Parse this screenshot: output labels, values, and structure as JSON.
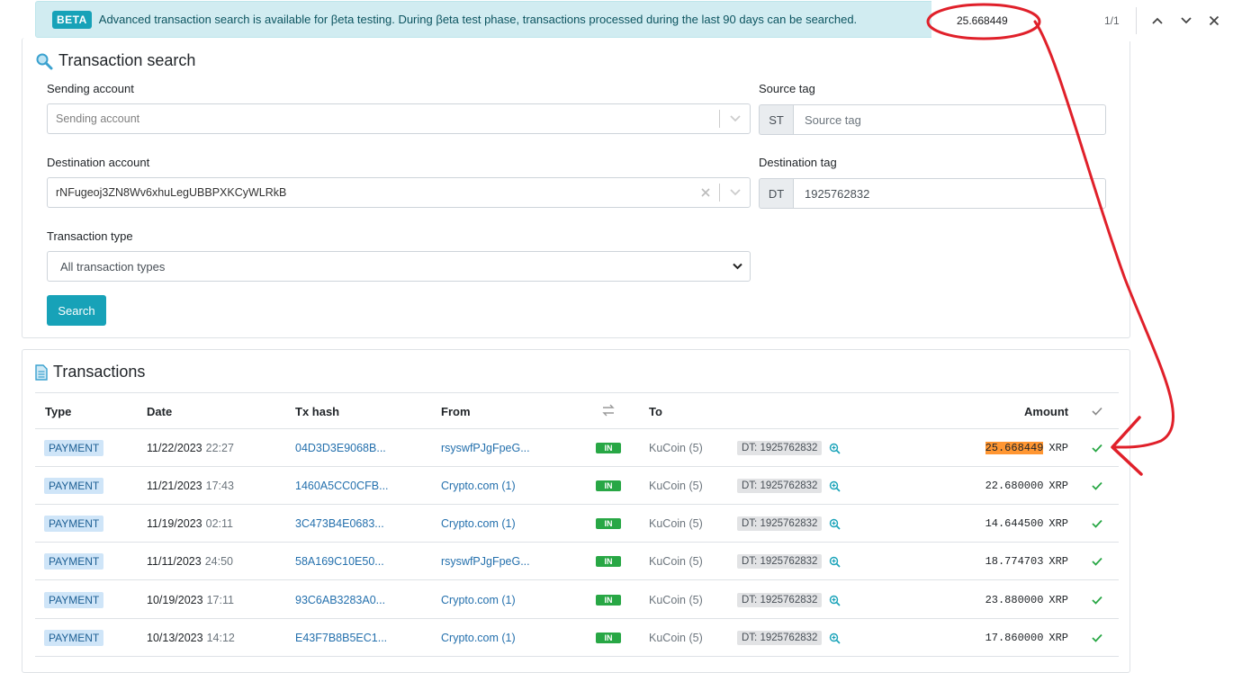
{
  "banner": {
    "badge": "BETA",
    "text": "Advanced transaction search is available for βeta testing. During βeta test phase, transactions processed during the last 90 days can be searched."
  },
  "find_bar": {
    "query": "25.668449",
    "count": "1/1"
  },
  "search": {
    "title": "Transaction search",
    "sending_account": {
      "label": "Sending account",
      "placeholder": "Sending account"
    },
    "source_tag": {
      "label": "Source tag",
      "addon": "ST",
      "placeholder": "Source tag"
    },
    "destination_account": {
      "label": "Destination account",
      "value": "rNFugeoj3ZN8Wv6xhuLegUBBPXKCyWLRkB"
    },
    "destination_tag": {
      "label": "Destination tag",
      "addon": "DT",
      "value": "1925762832"
    },
    "transaction_type": {
      "label": "Transaction type",
      "value": "All transaction types"
    },
    "button": "Search"
  },
  "transactions": {
    "title": "Transactions",
    "headers": {
      "type": "Type",
      "date": "Date",
      "hash": "Tx hash",
      "from": "From",
      "to": "To",
      "amount": "Amount"
    },
    "rows": [
      {
        "type": "PAYMENT",
        "date": "11/22/2023",
        "time": "22:27",
        "hash": "04D3D3E9068B...",
        "from": "rsyswfPJgFpeG...",
        "dir": "IN",
        "to": "KuCoin (5)",
        "dt": "DT: 1925762832",
        "amount": "25.668449",
        "currency": "XRP"
      },
      {
        "type": "PAYMENT",
        "date": "11/21/2023",
        "time": "17:43",
        "hash": "1460A5CC0CFB...",
        "from": "Crypto.com (1)",
        "dir": "IN",
        "to": "KuCoin (5)",
        "dt": "DT: 1925762832",
        "amount": "22.680000",
        "currency": "XRP"
      },
      {
        "type": "PAYMENT",
        "date": "11/19/2023",
        "time": "02:11",
        "hash": "3C473B4E0683...",
        "from": "Crypto.com (1)",
        "dir": "IN",
        "to": "KuCoin (5)",
        "dt": "DT: 1925762832",
        "amount": "14.644500",
        "currency": "XRP"
      },
      {
        "type": "PAYMENT",
        "date": "11/11/2023",
        "time": "24:50",
        "hash": "58A169C10E50...",
        "from": "rsyswfPJgFpeG...",
        "dir": "IN",
        "to": "KuCoin (5)",
        "dt": "DT: 1925762832",
        "amount": "18.774703",
        "currency": "XRP"
      },
      {
        "type": "PAYMENT",
        "date": "10/19/2023",
        "time": "17:11",
        "hash": "93C6AB3283A0...",
        "from": "Crypto.com (1)",
        "dir": "IN",
        "to": "KuCoin (5)",
        "dt": "DT: 1925762832",
        "amount": "23.880000",
        "currency": "XRP"
      },
      {
        "type": "PAYMENT",
        "date": "10/13/2023",
        "time": "14:12",
        "hash": "E43F7B8B5EC1...",
        "from": "Crypto.com (1)",
        "dir": "IN",
        "to": "KuCoin (5)",
        "dt": "DT: 1925762832",
        "amount": "17.860000",
        "currency": "XRP"
      }
    ]
  },
  "colors": {
    "accent": "#17a2b8",
    "in_badge": "#28a745",
    "highlight": "#ff9632",
    "annotation": "#e0202a"
  },
  "icons": {
    "search_title": "magnifier-icon",
    "transactions_title": "document-icon",
    "swap": "swap-arrows-icon",
    "check": "check-icon",
    "zoom": "zoom-in-icon"
  }
}
